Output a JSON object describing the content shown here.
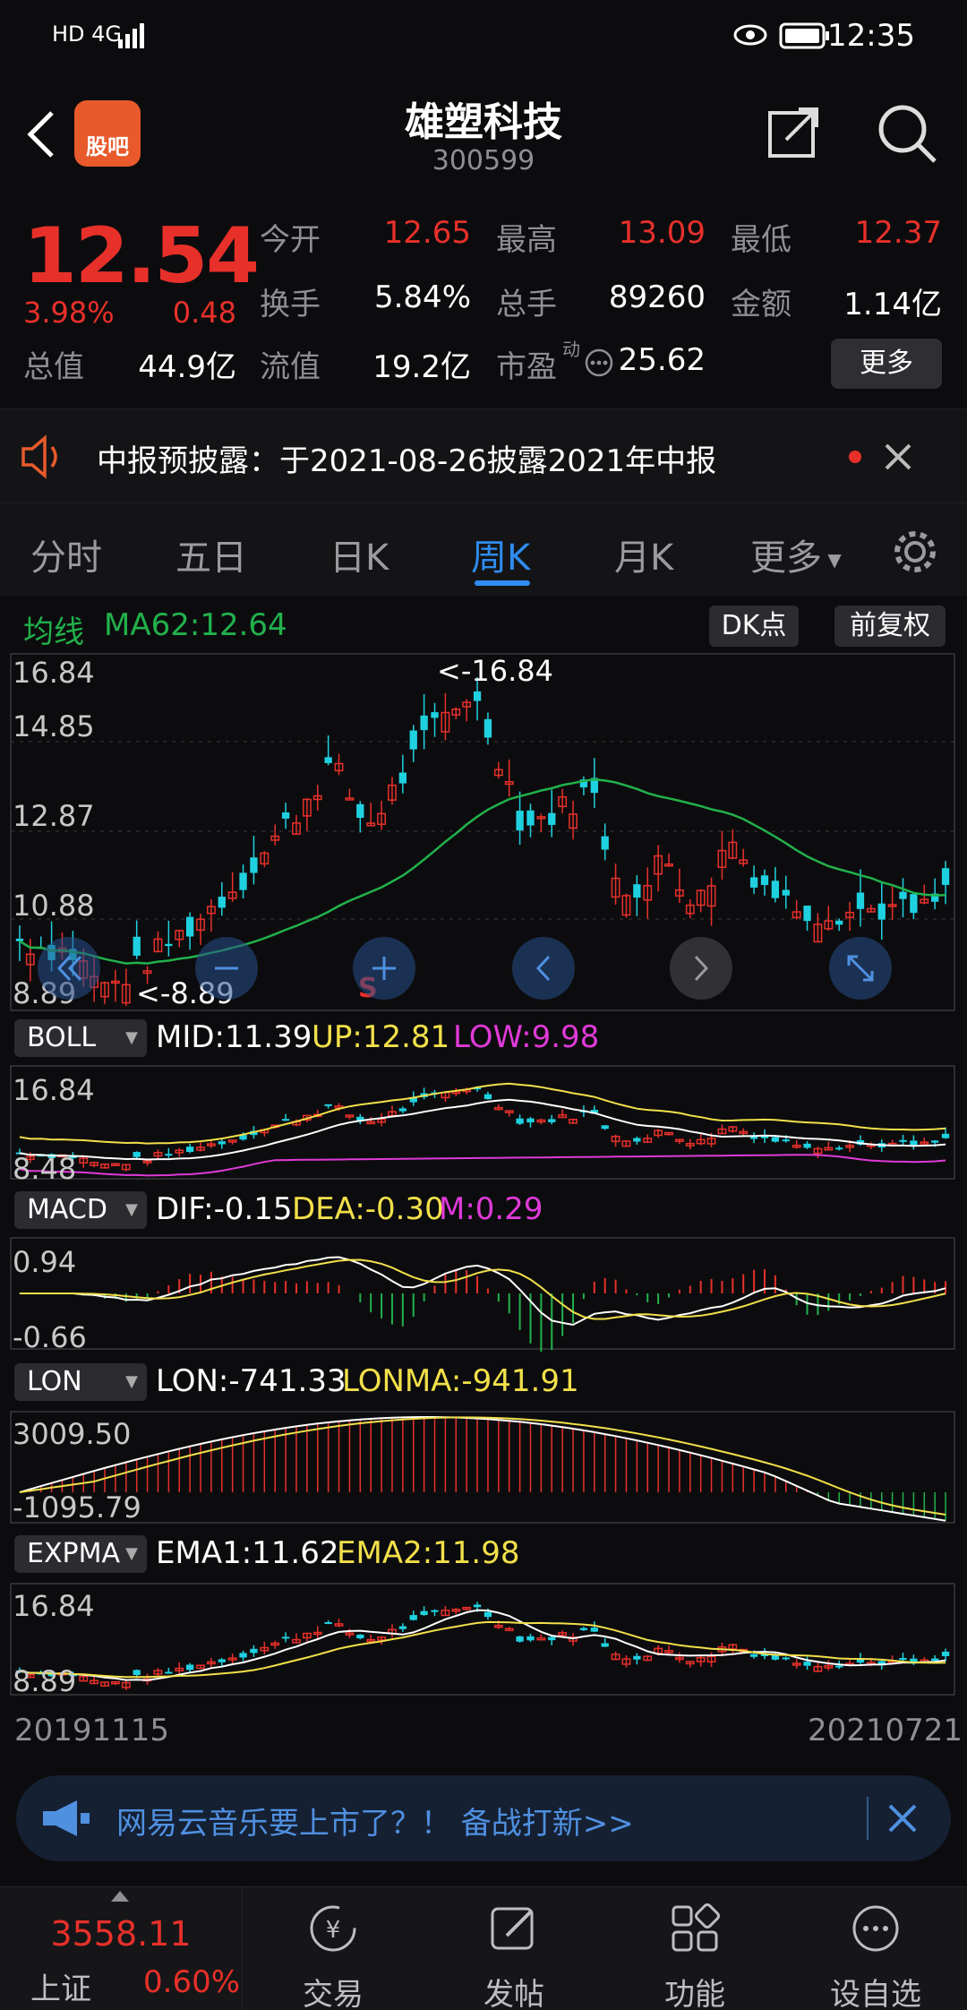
{
  "status": {
    "net": "HD 4G",
    "time": "12:35"
  },
  "header": {
    "logo_text": "股吧",
    "title": "雄塑科技",
    "code": "300599"
  },
  "quote": {
    "price": "12.54",
    "change_pct": "3.98%",
    "change": "0.48",
    "open_label": "今开",
    "open": "12.65",
    "high_label": "最高",
    "high": "13.09",
    "low_label": "最低",
    "low": "12.37",
    "turnover_label": "换手",
    "turnover": "5.84%",
    "volume_label": "总手",
    "volume": "89260",
    "amount_label": "金额",
    "amount": "1.14亿",
    "mktcap_label": "总值",
    "mktcap": "44.9亿",
    "float_label": "流值",
    "float": "19.2亿",
    "pe_label": "市盈",
    "pe_sup": "动",
    "pe": "25.62",
    "more_label": "更多"
  },
  "notice": {
    "text": "中报预披露：于2021-08-26披露2021年中报"
  },
  "tabs": [
    {
      "label": "分时"
    },
    {
      "label": "五日"
    },
    {
      "label": "日K"
    },
    {
      "label": "周K"
    },
    {
      "label": "月K"
    },
    {
      "label": "更多"
    }
  ],
  "ma_row": {
    "label": "均线",
    "ma": "MA62:12.64",
    "dk_label": "DK点",
    "fq_label": "前复权"
  },
  "kline": {
    "y_labels": [
      "16.84",
      "14.85",
      "12.87",
      "10.88",
      "8.89"
    ],
    "max_note": "<-16.84",
    "min_note": "<-8.89",
    "s_marker": "S"
  },
  "boll": {
    "name": "BOLL",
    "mid": "MID:11.39",
    "up": "UP:12.81",
    "low": "LOW:9.98",
    "y_top": "16.84",
    "y_bottom": "8.48"
  },
  "macd": {
    "name": "MACD",
    "dif": "DIF:-0.15",
    "dea": "DEA:-0.30",
    "m": "M:0.29",
    "y_top": "0.94",
    "y_bottom": "-0.66"
  },
  "lon": {
    "name": "LON",
    "lon": "LON:-741.33",
    "lonma": "LONMA:-941.91",
    "y_top": "3009.50",
    "y_bottom": "-1095.79"
  },
  "expma": {
    "name": "EXPMA",
    "ema1": "EMA1:11.62",
    "ema2": "EMA2:11.98",
    "y_top": "16.84",
    "y_bottom": "8.89"
  },
  "dates": {
    "start": "20191115",
    "end": "20210721"
  },
  "banner": {
    "text": "网易云音乐要上市了？！ 备战打新>>"
  },
  "nav": {
    "index_value": "3558.11",
    "index_name": "上证",
    "index_pct": "0.60%",
    "items": [
      {
        "label": "交易"
      },
      {
        "label": "发帖"
      },
      {
        "label": "功能"
      },
      {
        "label": "设自选"
      }
    ]
  },
  "colors": {
    "up": "#e8302a",
    "down": "#1fd1e0",
    "accent": "#2f8cf0",
    "ma": "#22b14c",
    "yellow": "#f2e04a",
    "magenta": "#e03ad8"
  }
}
